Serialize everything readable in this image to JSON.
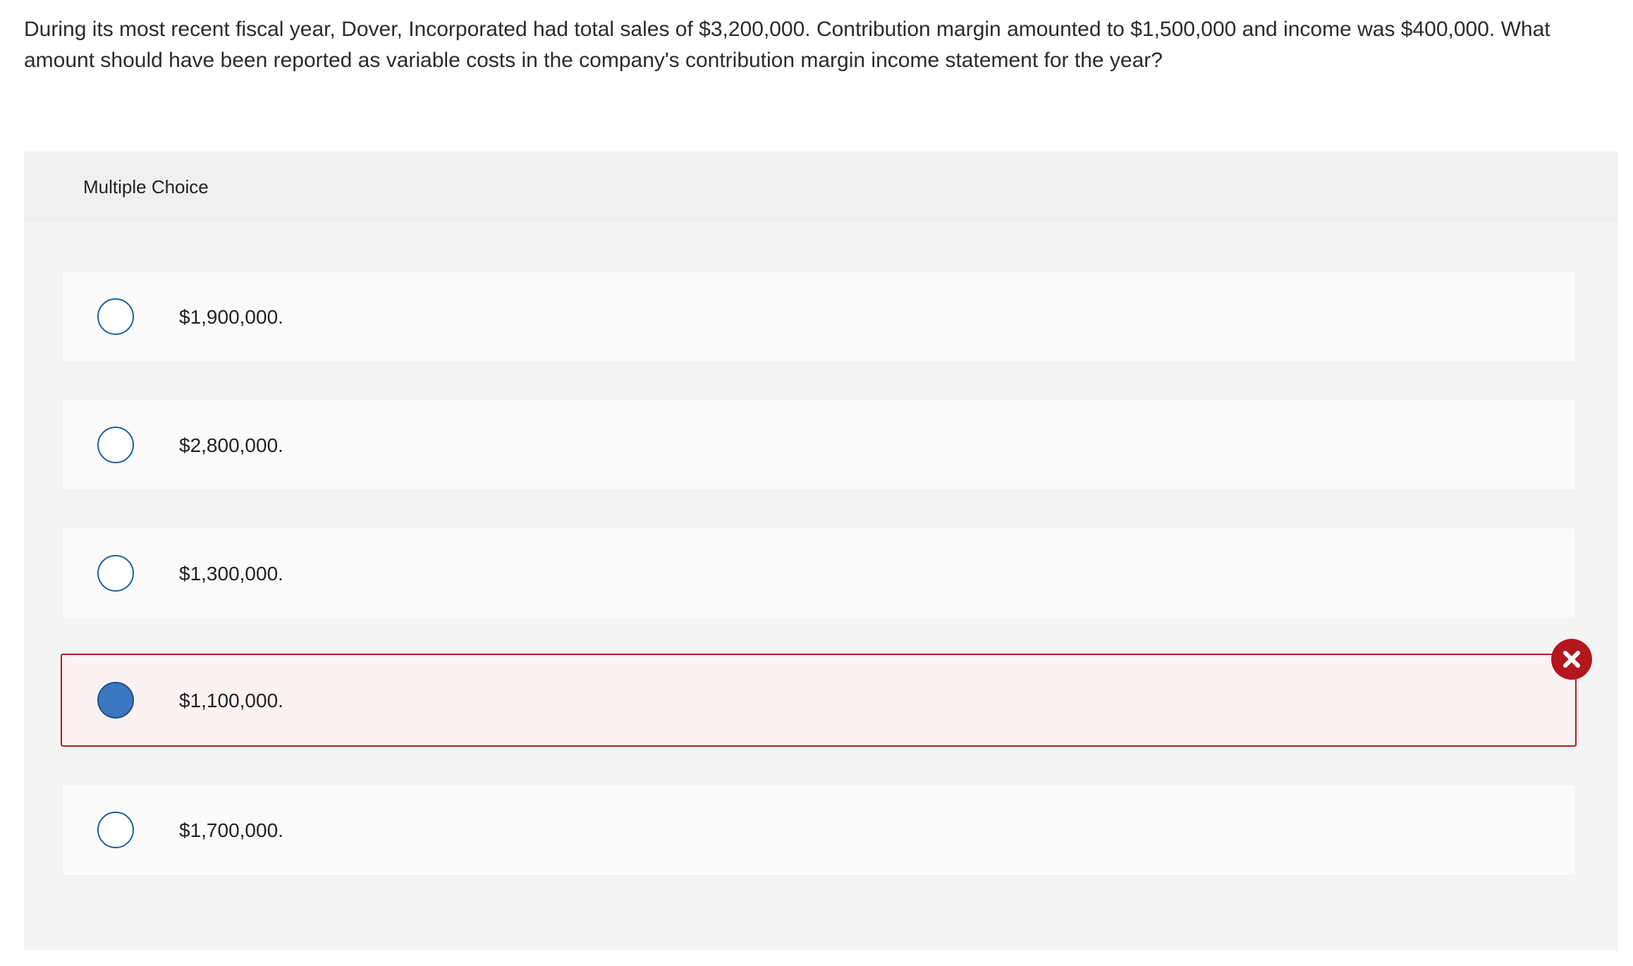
{
  "question": {
    "text": "During its most recent fiscal year, Dover, Incorporated had total sales of $3,200,000. Contribution margin amounted to $1,500,000 and income was $400,000. What amount should have been reported as variable costs in the company's contribution margin income statement for the year?"
  },
  "panel": {
    "title": "Multiple Choice"
  },
  "choices": [
    {
      "label": "$1,900,000.",
      "selected": false,
      "status": "none"
    },
    {
      "label": "$2,800,000.",
      "selected": false,
      "status": "none"
    },
    {
      "label": "$1,300,000.",
      "selected": false,
      "status": "none"
    },
    {
      "label": "$1,100,000.",
      "selected": true,
      "status": "incorrect"
    },
    {
      "label": "$1,700,000.",
      "selected": false,
      "status": "none"
    }
  ],
  "feedback": {
    "icon": "close-icon",
    "color": "#b3161c"
  },
  "colors": {
    "radio_border": "#1e5f9e",
    "radio_selected_fill": "#3b78c2",
    "wrong_border": "#b01c22",
    "wrong_background": "#fcf2f2",
    "panel_background": "#f4f4f4"
  }
}
